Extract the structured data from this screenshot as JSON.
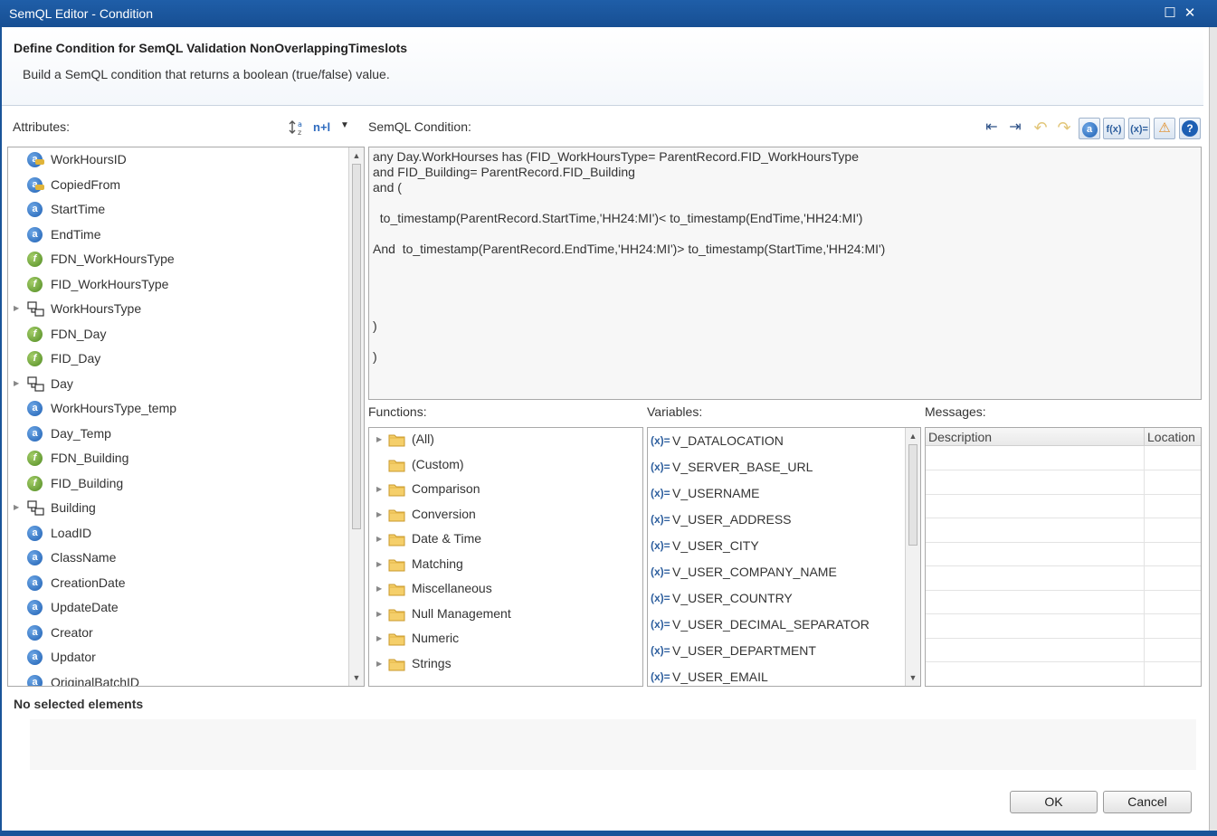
{
  "window": {
    "title": "SemQL Editor - Condition",
    "maximize_glyph": "☐",
    "close_glyph": "✕"
  },
  "header": {
    "title": "Define Condition for SemQL Validation NonOverlappingTimeslots",
    "subtitle": "Build a SemQL condition that returns a boolean (true/false) value."
  },
  "attributes": {
    "label": "Attributes:",
    "sort_icon": "sort-az-icon",
    "toggle_label": "n+l",
    "items": [
      {
        "label": "WorkHoursID",
        "icon": "key",
        "expandable": false
      },
      {
        "label": "CopiedFrom",
        "icon": "key",
        "expandable": false
      },
      {
        "label": "StartTime",
        "icon": "a",
        "expandable": false
      },
      {
        "label": "EndTime",
        "icon": "a",
        "expandable": false
      },
      {
        "label": "FDN_WorkHoursType",
        "icon": "f",
        "expandable": false
      },
      {
        "label": "FID_WorkHoursType",
        "icon": "f",
        "expandable": false
      },
      {
        "label": "WorkHoursType",
        "icon": "ref",
        "expandable": true
      },
      {
        "label": "FDN_Day",
        "icon": "f",
        "expandable": false
      },
      {
        "label": "FID_Day",
        "icon": "f",
        "expandable": false
      },
      {
        "label": "Day",
        "icon": "ref",
        "expandable": true
      },
      {
        "label": "WorkHoursType_temp",
        "icon": "a",
        "expandable": false
      },
      {
        "label": "Day_Temp",
        "icon": "a",
        "expandable": false
      },
      {
        "label": "FDN_Building",
        "icon": "f",
        "expandable": false
      },
      {
        "label": "FID_Building",
        "icon": "f",
        "expandable": false
      },
      {
        "label": "Building",
        "icon": "ref",
        "expandable": true
      },
      {
        "label": "LoadID",
        "icon": "a",
        "expandable": false
      },
      {
        "label": "ClassName",
        "icon": "a",
        "expandable": false
      },
      {
        "label": "CreationDate",
        "icon": "a",
        "expandable": false
      },
      {
        "label": "UpdateDate",
        "icon": "a",
        "expandable": false
      },
      {
        "label": "Creator",
        "icon": "a",
        "expandable": false
      },
      {
        "label": "Updator",
        "icon": "a",
        "expandable": false
      },
      {
        "label": "OriginalBatchID",
        "icon": "a",
        "expandable": false
      }
    ]
  },
  "condition": {
    "label": "SemQL Condition:",
    "text": "any Day.WorkHourses has (FID_WorkHoursType= ParentRecord.FID_WorkHoursType\nand FID_Building= ParentRecord.FID_Building\nand (\n\n  to_timestamp(ParentRecord.StartTime,'HH24:MI')< to_timestamp(EndTime,'HH24:MI')\n\nAnd  to_timestamp(ParentRecord.EndTime,'HH24:MI')> to_timestamp(StartTime,'HH24:MI')\n\n\n\n\n)\n\n)"
  },
  "toolbar": {
    "buttons": [
      {
        "name": "unindent-button",
        "icon": "unindent-icon",
        "glyph": "⇤"
      },
      {
        "name": "indent-button",
        "icon": "indent-icon",
        "glyph": "⇥"
      },
      {
        "name": "undo-button",
        "icon": "undo-icon",
        "glyph": "↶"
      },
      {
        "name": "redo-button",
        "icon": "redo-icon",
        "glyph": "↷"
      },
      {
        "name": "show-attributes-button",
        "icon": "attribute-icon",
        "glyph": "a"
      },
      {
        "name": "show-functions-button",
        "icon": "function-icon",
        "glyph": "f(x)"
      },
      {
        "name": "show-variables-button",
        "icon": "variable-icon",
        "glyph": "(x)="
      },
      {
        "name": "show-messages-button",
        "icon": "warning-error-icon",
        "glyph": "⚠"
      },
      {
        "name": "help-button",
        "icon": "help-icon",
        "glyph": "?"
      }
    ]
  },
  "functions": {
    "label": "Functions:",
    "items": [
      {
        "label": "(All)",
        "expandable": true
      },
      {
        "label": "(Custom)",
        "expandable": false
      },
      {
        "label": "Comparison",
        "expandable": true
      },
      {
        "label": "Conversion",
        "expandable": true
      },
      {
        "label": "Date & Time",
        "expandable": true
      },
      {
        "label": "Matching",
        "expandable": true
      },
      {
        "label": "Miscellaneous",
        "expandable": true
      },
      {
        "label": "Null Management",
        "expandable": true
      },
      {
        "label": "Numeric",
        "expandable": true
      },
      {
        "label": "Strings",
        "expandable": true
      }
    ]
  },
  "variables": {
    "label": "Variables:",
    "icon_glyph": "(x)=",
    "items": [
      "V_DATALOCATION",
      "V_SERVER_BASE_URL",
      "V_USERNAME",
      "V_USER_ADDRESS",
      "V_USER_CITY",
      "V_USER_COMPANY_NAME",
      "V_USER_COUNTRY",
      "V_USER_DECIMAL_SEPARATOR",
      "V_USER_DEPARTMENT",
      "V_USER_EMAIL"
    ]
  },
  "messages": {
    "label": "Messages:",
    "columns": [
      "Description",
      "Location"
    ]
  },
  "selection": {
    "label": "No selected elements"
  },
  "footer": {
    "ok_label": "OK",
    "cancel_label": "Cancel"
  },
  "colors": {
    "titlebar": "#1f5ea8",
    "accent": "#1d5fb3",
    "folder": "#f2c55c"
  }
}
